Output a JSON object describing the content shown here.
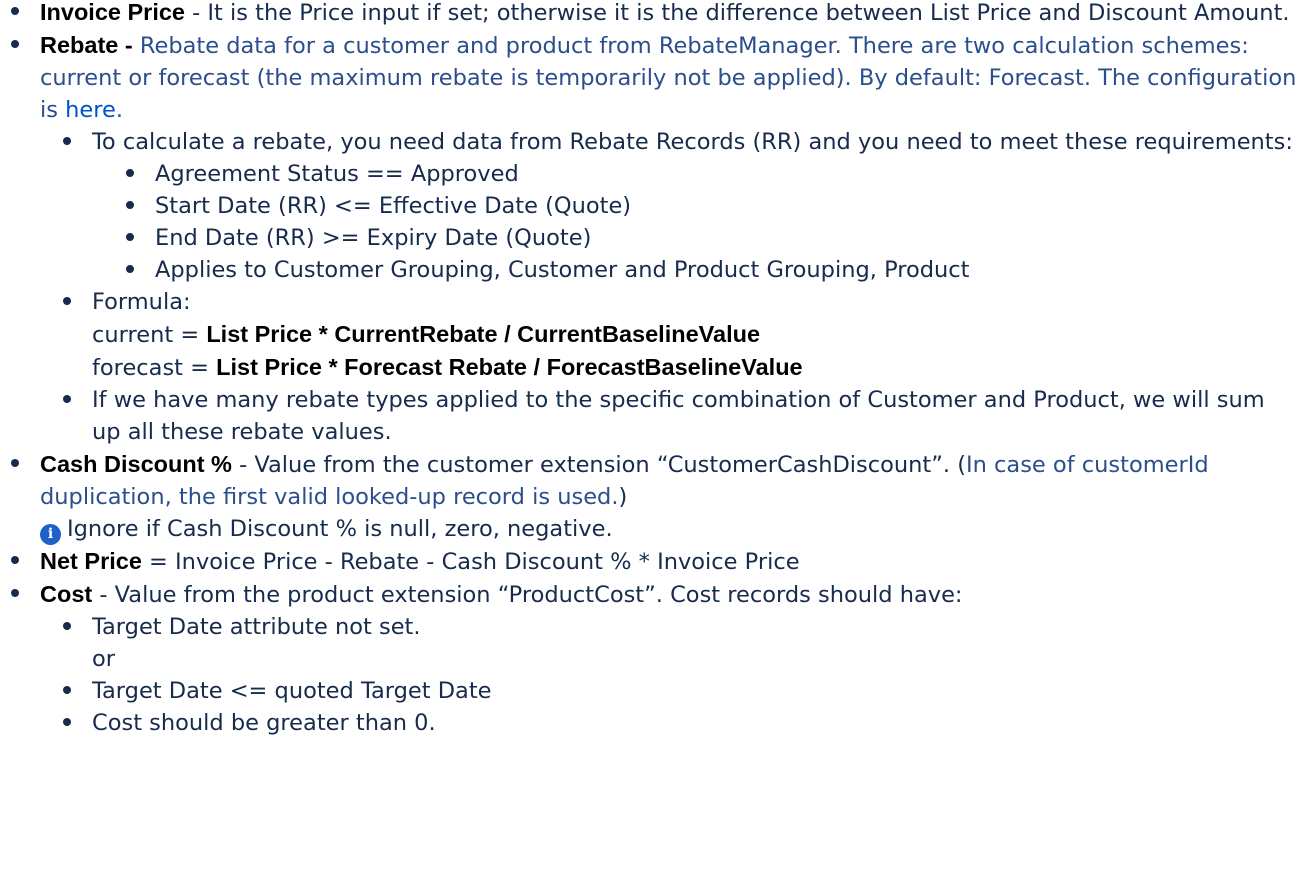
{
  "items": {
    "invoice": {
      "term": "Invoice Price",
      "text": " - It is the Price input if set; otherwise it is the difference between List Price and Discount Amount."
    },
    "rebate": {
      "term": "Rebate -",
      "text_a": " Rebate data for a customer and product from RebateManager.  There are two calculation schemes: current or forecast (the maximum rebate is temporarily not be applied). By default: Forecast. The configuration is ",
      "link": "here",
      "text_b": ".",
      "sub": {
        "req_intro": "To calculate a rebate, you need data from Rebate Records (RR) and you need to meet these requirements:",
        "reqs": [
          "Agreement Status == Approved",
          "Start Date (RR) <= Effective Date (Quote)",
          "End Date (RR) >= Expiry Date (Quote)",
          "Applies to Customer Grouping, Customer and Product Grouping, Product"
        ],
        "formula_label": "Formula:",
        "current_prefix": "current = ",
        "current_formula": "List Price * CurrentRebate / CurrentBaselineValue",
        "forecast_prefix": "forecast = ",
        "forecast_formula": "List Price * Forecast Rebate / ForecastBaselineValue",
        "sum_note": "If we have many rebate types applied to the specific combination of Customer and Product, we will sum up all these rebate values."
      }
    },
    "cash": {
      "term": "Cash Discount %",
      "text_a": " - Value from the customer extension “CustomerCashDiscount”. (",
      "text_blue": "In case of customerId duplication, the first valid looked-up record is used.",
      "text_b": ")",
      "info_icon": "info-icon",
      "note": "Ignore if Cash Discount % is null, zero, negative."
    },
    "net": {
      "term": "Net Price",
      "text": " = Invoice Price - Rebate - Cash Discount % * Invoice Price"
    },
    "cost": {
      "term": "Cost",
      "text": " - Value from the product extension “ProductCost”. Cost records should have:",
      "sub": {
        "a": "Target Date attribute not set.",
        "or": "or",
        "b": "Target Date <= quoted Target Date",
        "c": "Cost should be greater than 0."
      }
    }
  },
  "colors": {
    "text": "#172b4d",
    "term": "#000000",
    "blue_text": "#2b4e8c",
    "link": "#0052cc",
    "info_icon": "#1f5fc8"
  }
}
